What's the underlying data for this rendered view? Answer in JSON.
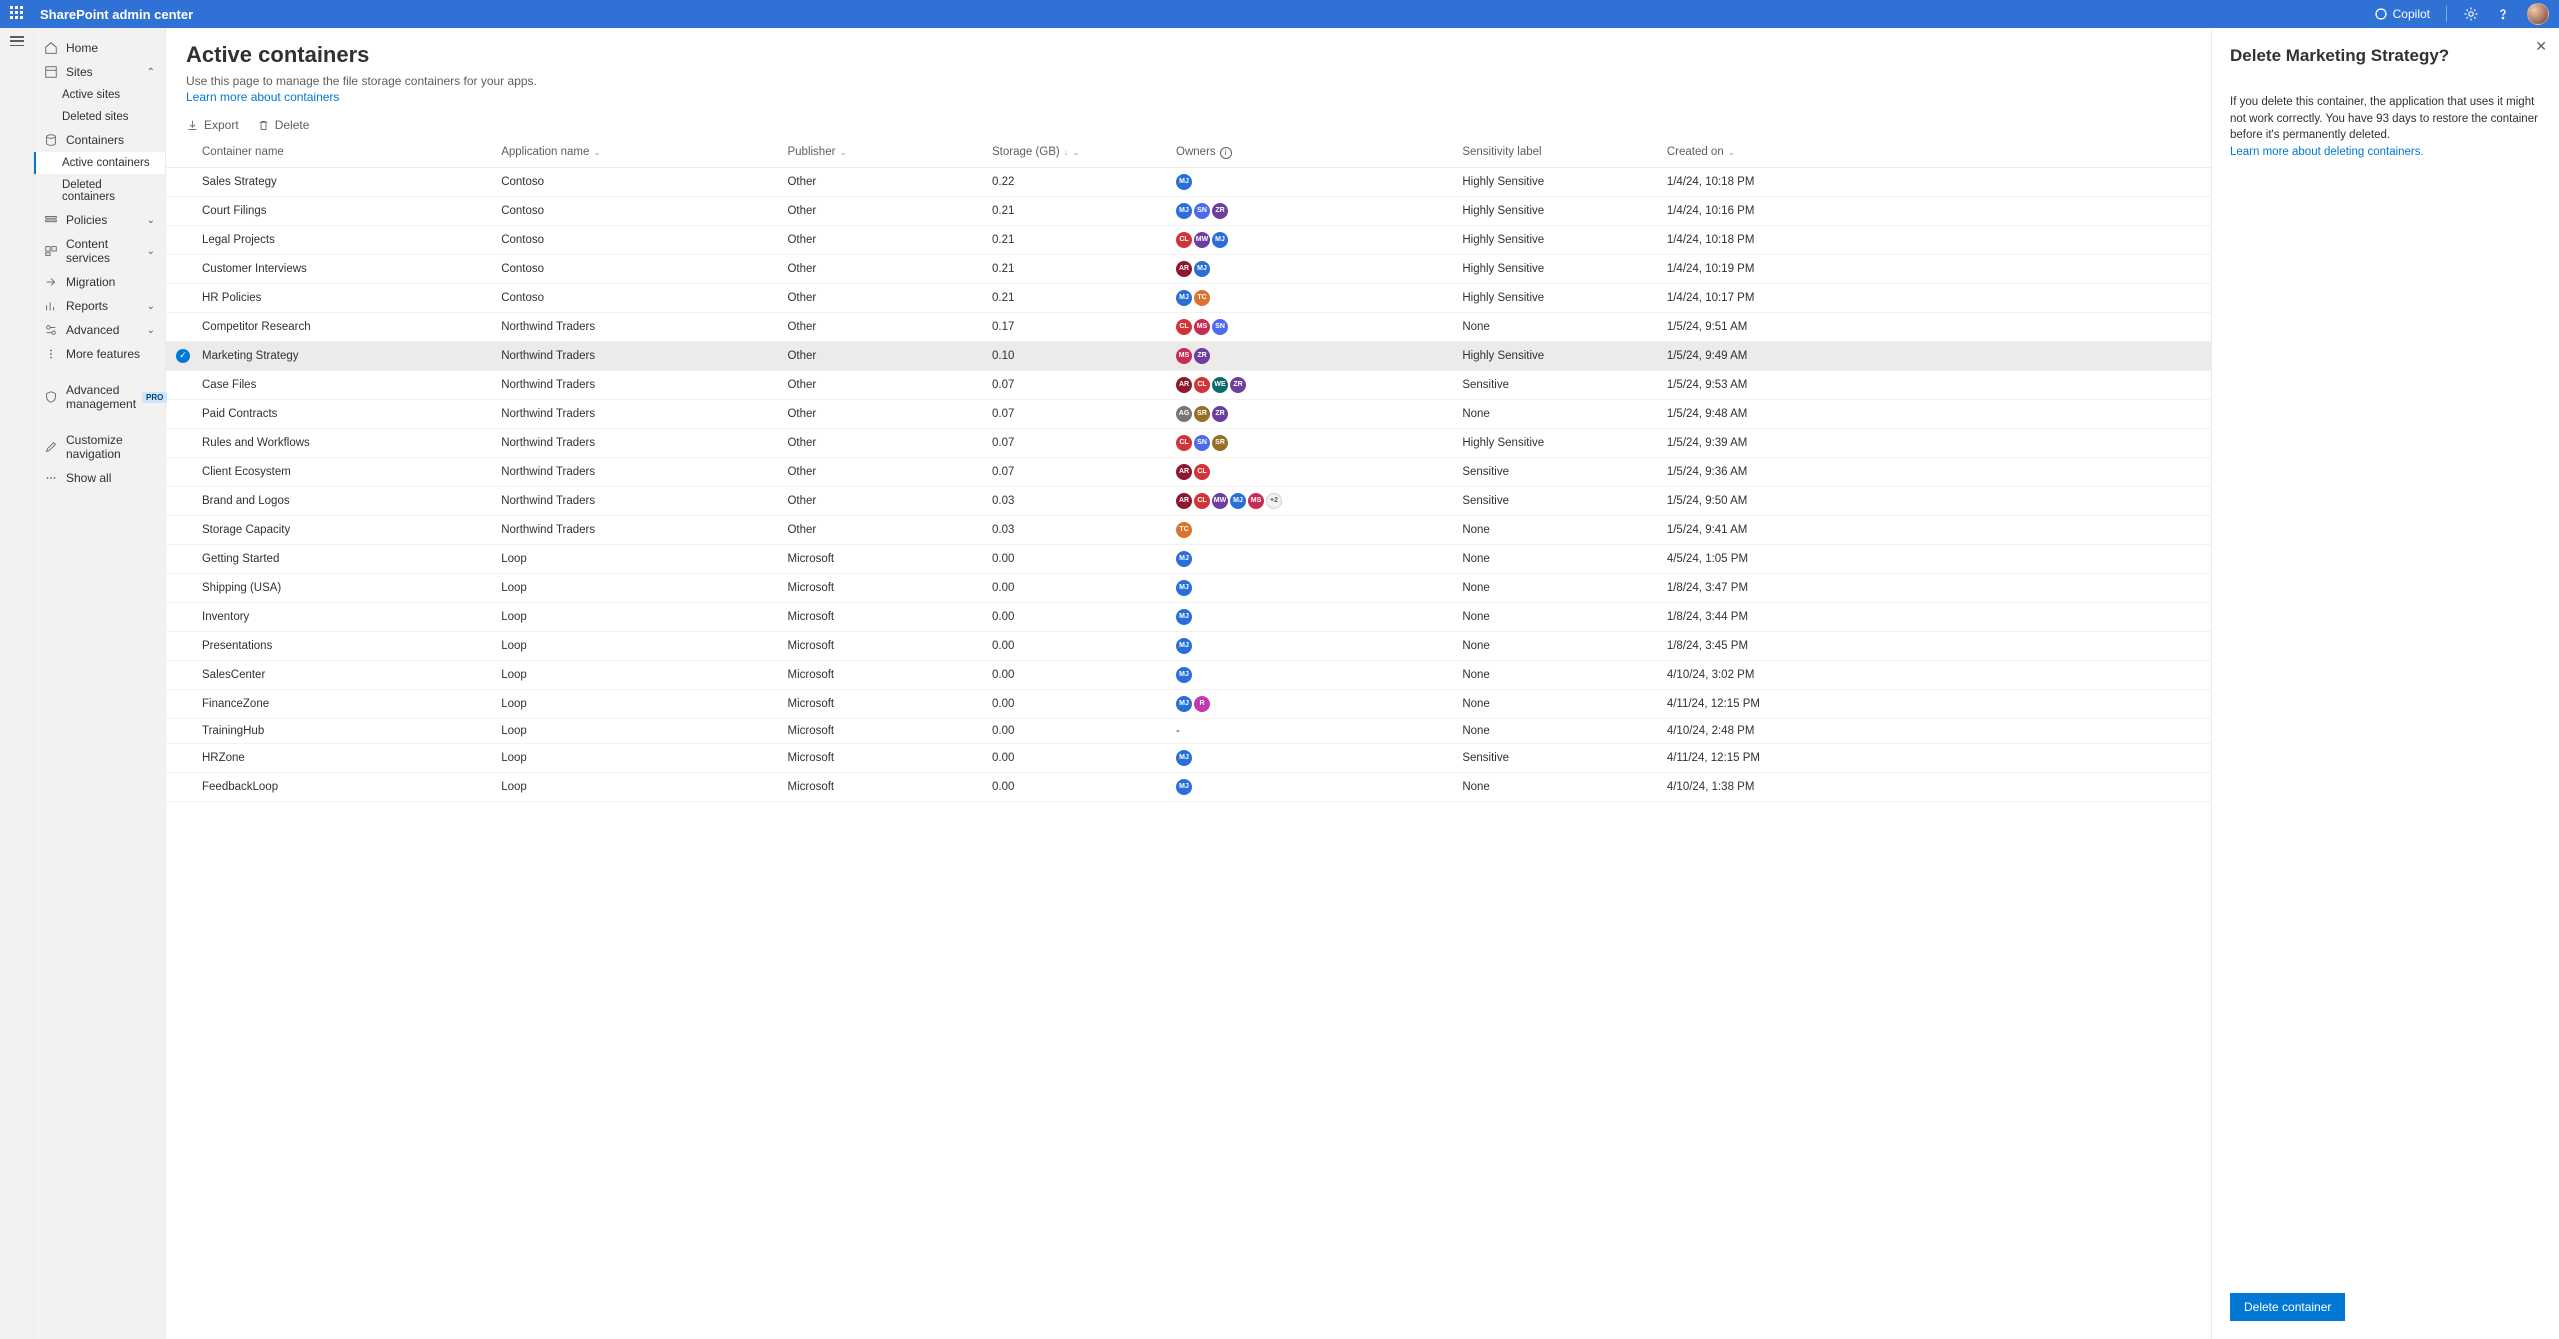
{
  "header": {
    "app_title": "SharePoint admin center",
    "copilot": "Copilot"
  },
  "nav": {
    "home": "Home",
    "sites": "Sites",
    "active_sites": "Active sites",
    "deleted_sites": "Deleted sites",
    "containers": "Containers",
    "active_containers": "Active containers",
    "deleted_containers": "Deleted containers",
    "policies": "Policies",
    "content_services": "Content services",
    "migration": "Migration",
    "reports": "Reports",
    "advanced": "Advanced",
    "more_features": "More features",
    "advanced_management": "Advanced management",
    "pro": "PRO",
    "customize_nav": "Customize navigation",
    "show_all": "Show all"
  },
  "page": {
    "title": "Active containers",
    "desc": "Use this page to manage the file storage containers for your apps.",
    "learn": "Learn more about containers"
  },
  "cmdbar": {
    "export": "Export",
    "delete": "Delete"
  },
  "columns": {
    "container": "Container name",
    "app": "Application name",
    "publisher": "Publisher",
    "storage": "Storage (GB)",
    "owners": "Owners",
    "sensitivity": "Sensitivity label",
    "created": "Created on"
  },
  "rows": [
    {
      "name": "Sales Strategy",
      "app": "Contoso",
      "pub": "Other",
      "storage": "0.22",
      "owners": [
        {
          "t": "MJ",
          "c": "#2a6fd7"
        }
      ],
      "sens": "Highly Sensitive",
      "created": "1/4/24, 10:18 PM"
    },
    {
      "name": "Court Filings",
      "app": "Contoso",
      "pub": "Other",
      "storage": "0.21",
      "owners": [
        {
          "t": "MJ",
          "c": "#2a6fd7"
        },
        {
          "t": "SN",
          "c": "#4f6bed"
        },
        {
          "t": "ZR",
          "c": "#6b3fa0"
        }
      ],
      "sens": "Highly Sensitive",
      "created": "1/4/24, 10:16 PM"
    },
    {
      "name": "Legal Projects",
      "app": "Contoso",
      "pub": "Other",
      "storage": "0.21",
      "owners": [
        {
          "t": "CL",
          "c": "#d13438"
        },
        {
          "t": "MW",
          "c": "#6b3fa0"
        },
        {
          "t": "MJ",
          "c": "#2a6fd7"
        }
      ],
      "sens": "Highly Sensitive",
      "created": "1/4/24, 10:18 PM"
    },
    {
      "name": "Customer Interviews",
      "app": "Contoso",
      "pub": "Other",
      "storage": "0.21",
      "owners": [
        {
          "t": "AR",
          "c": "#8e192e"
        },
        {
          "t": "MJ",
          "c": "#2a6fd7"
        }
      ],
      "sens": "Highly Sensitive",
      "created": "1/4/24, 10:19 PM"
    },
    {
      "name": "HR Policies",
      "app": "Contoso",
      "pub": "Other",
      "storage": "0.21",
      "owners": [
        {
          "t": "MJ",
          "c": "#2a6fd7"
        },
        {
          "t": "TC",
          "c": "#d8742e"
        }
      ],
      "sens": "Highly Sensitive",
      "created": "1/4/24, 10:17 PM"
    },
    {
      "name": "Competitor Research",
      "app": "Northwind Traders",
      "pub": "Other",
      "storage": "0.17",
      "owners": [
        {
          "t": "CL",
          "c": "#d13438"
        },
        {
          "t": "MS",
          "c": "#c72c55"
        },
        {
          "t": "SN",
          "c": "#4f6bed"
        }
      ],
      "sens": "None",
      "created": "1/5/24, 9:51 AM"
    },
    {
      "name": "Marketing Strategy",
      "app": "Northwind Traders",
      "pub": "Other",
      "storage": "0.10",
      "owners": [
        {
          "t": "MS",
          "c": "#c72c55"
        },
        {
          "t": "ZR",
          "c": "#6b3fa0"
        }
      ],
      "sens": "Highly Sensitive",
      "created": "1/5/24, 9:49 AM",
      "selected": true
    },
    {
      "name": "Case Files",
      "app": "Northwind Traders",
      "pub": "Other",
      "storage": "0.07",
      "owners": [
        {
          "t": "AR",
          "c": "#8e192e"
        },
        {
          "t": "CL",
          "c": "#d13438"
        },
        {
          "t": "WE",
          "c": "#0b6a6a"
        },
        {
          "t": "ZR",
          "c": "#6b3fa0"
        }
      ],
      "sens": "Sensitive",
      "created": "1/5/24, 9:53 AM"
    },
    {
      "name": "Paid Contracts",
      "app": "Northwind Traders",
      "pub": "Other",
      "storage": "0.07",
      "owners": [
        {
          "t": "AG",
          "c": "#7a7574"
        },
        {
          "t": "SR",
          "c": "#986f27"
        },
        {
          "t": "ZR",
          "c": "#6b3fa0"
        }
      ],
      "sens": "None",
      "created": "1/5/24, 9:48 AM"
    },
    {
      "name": "Rules and Workflows",
      "app": "Northwind Traders",
      "pub": "Other",
      "storage": "0.07",
      "owners": [
        {
          "t": "CL",
          "c": "#d13438"
        },
        {
          "t": "SN",
          "c": "#4f6bed"
        },
        {
          "t": "SR",
          "c": "#986f27"
        }
      ],
      "sens": "Highly Sensitive",
      "created": "1/5/24, 9:39 AM"
    },
    {
      "name": "Client Ecosystem",
      "app": "Northwind Traders",
      "pub": "Other",
      "storage": "0.07",
      "owners": [
        {
          "t": "AR",
          "c": "#8e192e"
        },
        {
          "t": "CL",
          "c": "#d13438"
        }
      ],
      "sens": "Sensitive",
      "created": "1/5/24, 9:36 AM"
    },
    {
      "name": "Brand and Logos",
      "app": "Northwind Traders",
      "pub": "Other",
      "storage": "0.03",
      "owners": [
        {
          "t": "AR",
          "c": "#8e192e"
        },
        {
          "t": "CL",
          "c": "#d13438"
        },
        {
          "t": "MW",
          "c": "#6b3fa0"
        },
        {
          "t": "MJ",
          "c": "#2a6fd7"
        },
        {
          "t": "MS",
          "c": "#c72c55"
        }
      ],
      "more": "+2",
      "sens": "Sensitive",
      "created": "1/5/24, 9:50 AM"
    },
    {
      "name": "Storage Capacity",
      "app": "Northwind Traders",
      "pub": "Other",
      "storage": "0.03",
      "owners": [
        {
          "t": "TC",
          "c": "#d8742e"
        }
      ],
      "sens": "None",
      "created": "1/5/24, 9:41 AM"
    },
    {
      "name": "Getting Started",
      "app": "Loop",
      "pub": "Microsoft",
      "storage": "0.00",
      "owners": [
        {
          "t": "MJ",
          "c": "#2a6fd7"
        }
      ],
      "sens": "None",
      "created": "4/5/24, 1:05 PM"
    },
    {
      "name": "Shipping (USA)",
      "app": "Loop",
      "pub": "Microsoft",
      "storage": "0.00",
      "owners": [
        {
          "t": "MJ",
          "c": "#2a6fd7"
        }
      ],
      "sens": "None",
      "created": "1/8/24, 3:47 PM"
    },
    {
      "name": "Inventory",
      "app": "Loop",
      "pub": "Microsoft",
      "storage": "0.00",
      "owners": [
        {
          "t": "MJ",
          "c": "#2a6fd7"
        }
      ],
      "sens": "None",
      "created": "1/8/24, 3:44 PM"
    },
    {
      "name": "Presentations",
      "app": "Loop",
      "pub": "Microsoft",
      "storage": "0.00",
      "owners": [
        {
          "t": "MJ",
          "c": "#2a6fd7"
        }
      ],
      "sens": "None",
      "created": "1/8/24, 3:45 PM"
    },
    {
      "name": "SalesCenter",
      "app": "Loop",
      "pub": "Microsoft",
      "storage": "0.00",
      "owners": [
        {
          "t": "MJ",
          "c": "#2a6fd7"
        }
      ],
      "sens": "None",
      "created": "4/10/24, 3:02 PM"
    },
    {
      "name": "FinanceZone",
      "app": "Loop",
      "pub": "Microsoft",
      "storage": "0.00",
      "owners": [
        {
          "t": "MJ",
          "c": "#2a6fd7"
        },
        {
          "t": "R",
          "c": "#c239b3"
        }
      ],
      "sens": "None",
      "created": "4/11/24, 12:15 PM"
    },
    {
      "name": "TrainingHub",
      "app": "Loop",
      "pub": "Microsoft",
      "storage": "0.00",
      "owners": [],
      "ownersText": "-",
      "sens": "None",
      "created": "4/10/24, 2:48 PM"
    },
    {
      "name": "HRZone",
      "app": "Loop",
      "pub": "Microsoft",
      "storage": "0.00",
      "owners": [
        {
          "t": "MJ",
          "c": "#2a6fd7"
        }
      ],
      "sens": "Sensitive",
      "created": "4/11/24, 12:15 PM"
    },
    {
      "name": "FeedbackLoop",
      "app": "Loop",
      "pub": "Microsoft",
      "storage": "0.00",
      "owners": [
        {
          "t": "MJ",
          "c": "#2a6fd7"
        }
      ],
      "sens": "None",
      "created": "4/10/24, 1:38 PM"
    }
  ],
  "panel": {
    "title": "Delete Marketing Strategy?",
    "warn1": "If you delete this container, the application that uses it might not work correctly.",
    "warn2": "You have 93 days to restore the container before it's permanently deleted.",
    "learn": "Learn more about deleting containers.",
    "button": "Delete container"
  }
}
